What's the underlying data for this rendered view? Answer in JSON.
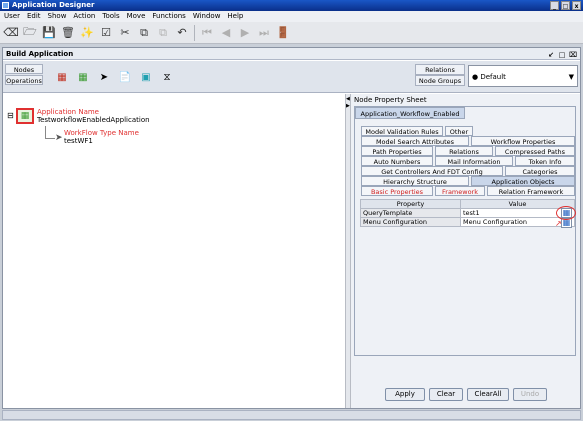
{
  "window": {
    "title": "Application Designer",
    "controls": [
      "_",
      "□",
      "x"
    ]
  },
  "menu": [
    "User",
    "Edit",
    "Show",
    "Action",
    "Tools",
    "Move",
    "Functions",
    "Window",
    "Help"
  ],
  "frame": {
    "title": "Build Application"
  },
  "palette": {
    "tabs": [
      "Nodes",
      "Operations"
    ],
    "right_tabs": [
      "Relations",
      "Node Groups"
    ],
    "default_select": "● Default"
  },
  "tree": {
    "root_label": "Application Name",
    "root_value": "TestworkflowEnabledApplication",
    "child_label": "WorkFlow Type Name",
    "child_value": "testWF1"
  },
  "propsheet": {
    "title": "Node Property Sheet",
    "node_tab": "Application_Workflow_Enabled",
    "tabs": {
      "row1": [
        "Model Validation Rules",
        "Other"
      ],
      "row2": [
        "Model Search Attributes",
        "Workflow Properties"
      ],
      "row3": [
        "Path Properties",
        "Relations",
        "Compressed Paths"
      ],
      "row4": [
        "Auto Numbers",
        "Mail Information",
        "Token Info"
      ],
      "row5": [
        "Get Controllers And FDT Config",
        "Categories"
      ],
      "row6": [
        "Hierarchy Structure",
        "Application Objects"
      ],
      "row7": [
        "Basic Properties",
        "Framework",
        "Relation Framework"
      ]
    },
    "table": {
      "headers": [
        "Property",
        "Value"
      ],
      "rows": [
        {
          "property": "QueryTemplate",
          "value": "test1"
        },
        {
          "property": "Menu Configuration",
          "value": "Menu Configuration"
        }
      ]
    }
  },
  "buttons": {
    "apply": "Apply",
    "clear": "Clear",
    "clear_all": "ClearAll",
    "undo": "Undo"
  }
}
